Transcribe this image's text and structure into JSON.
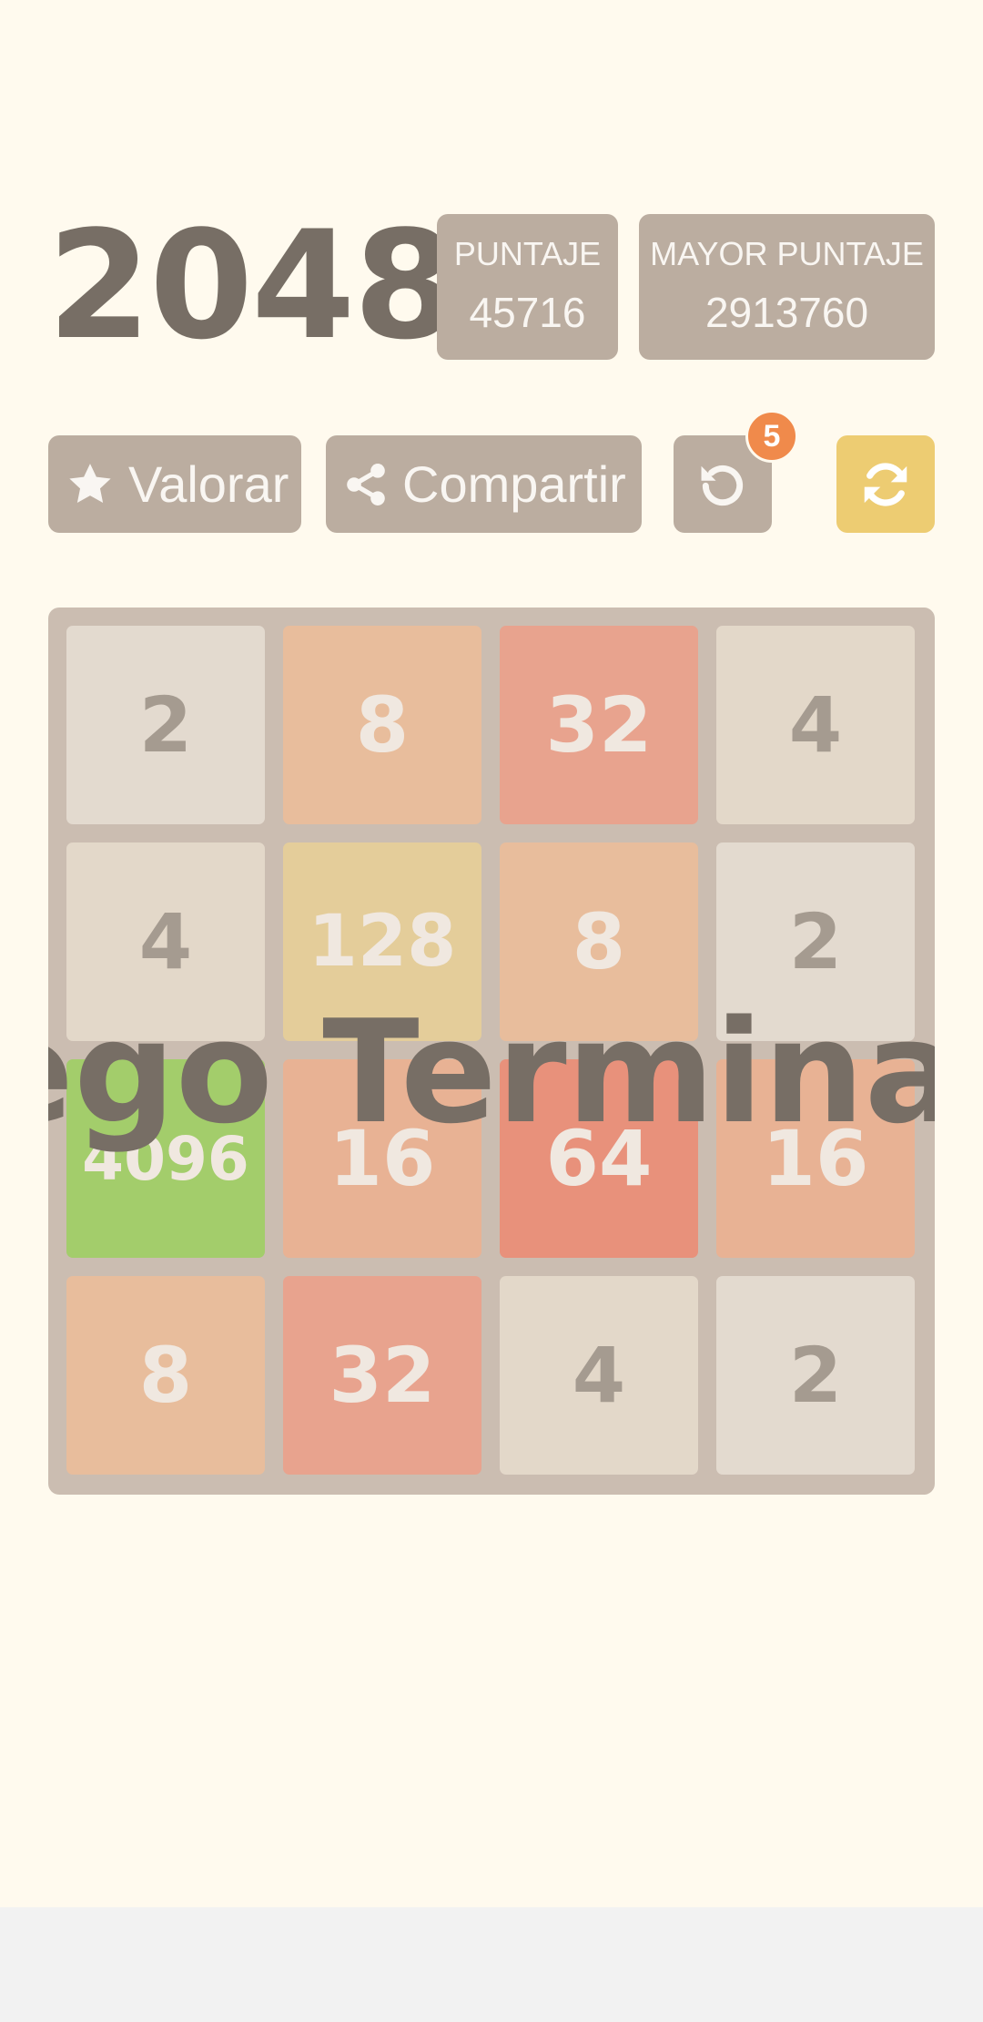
{
  "header": {
    "title": "2048",
    "score_label": "PUNTAJE",
    "score_value": "45716",
    "best_label": "MAYOR PUNTAJE",
    "best_value": "2913760"
  },
  "toolbar": {
    "rate_label": "Valorar",
    "rate_icon": "star-icon",
    "share_label": "Compartir",
    "share_icon": "share-icon",
    "undo_icon": "undo-icon",
    "undo_count": "5",
    "new_game_icon": "refresh-icon"
  },
  "board": {
    "size": 4,
    "tiles": [
      [
        "2",
        "8",
        "32",
        "4"
      ],
      [
        "4",
        "128",
        "8",
        "2"
      ],
      [
        "4096",
        "16",
        "64",
        "16"
      ],
      [
        "8",
        "32",
        "4",
        "2"
      ]
    ]
  },
  "overlay": {
    "text": "Juego Terminado"
  },
  "colors": {
    "background": "#fffaee",
    "board": "#cbbdb1",
    "button": "#bbada0",
    "new_game_button": "#edcc72",
    "badge": "#f08a4b",
    "title_text": "#776e65",
    "tile_2": "#e3dacf",
    "tile_4": "#e3d8c9",
    "tile_8": "#e8bd9c",
    "tile_16": "#e8b294",
    "tile_32": "#e8a38e",
    "tile_64": "#e8917b",
    "tile_128": "#e4cd9a",
    "tile_4096": "#a3cd6b"
  }
}
